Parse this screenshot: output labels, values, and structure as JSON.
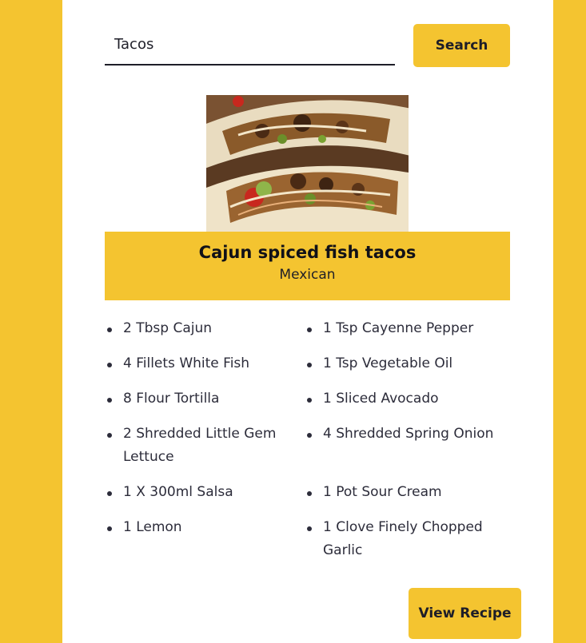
{
  "search": {
    "value": "Tacos",
    "button_label": "Search"
  },
  "recipe": {
    "image_subject": "fish tacos photo",
    "title": "Cajun spiced fish tacos",
    "cuisine": "Mexican",
    "ingredients": [
      "2 Tbsp Cajun",
      "1 Tsp Cayenne Pepper",
      "4 Fillets White Fish",
      "1 Tsp Vegetable Oil",
      "8 Flour Tortilla",
      "1 Sliced Avocado",
      "2 Shredded Little Gem Lettuce",
      "4 Shredded Spring Onion",
      "1 X 300ml Salsa",
      "1 Pot Sour Cream",
      "1 Lemon",
      "1 Clove Finely Chopped Garlic"
    ],
    "view_button_label": "View Recipe"
  },
  "colors": {
    "accent": "#f4c430",
    "panel": "#ffffff",
    "text": "#2c2c3a"
  }
}
